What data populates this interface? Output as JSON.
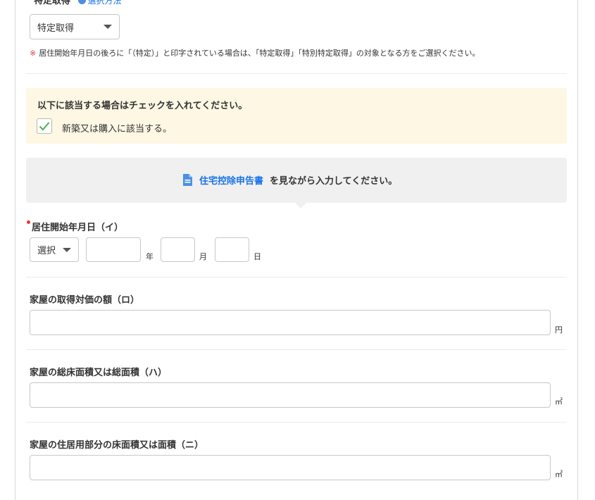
{
  "acquisition": {
    "label": "特定取得",
    "help_text": "選択方法",
    "select_value": "特定取得",
    "note_mark": "※",
    "note_text": "居住開始年月日の後ろに「（特定）」と印字されている場合は、「特定取得」「特別特定取得」の対象となる方をご選択ください。"
  },
  "notice": {
    "title": "以下に該当する場合はチェックを入れてください。",
    "checkbox_label": "新築又は購入に該当する。",
    "checked": true
  },
  "reference": {
    "doc_name": "住宅控除申告書",
    "suffix": "を見ながら入力してください。"
  },
  "residence_date": {
    "label": "居住開始年月日（イ）",
    "era_select": "選択",
    "year_unit": "年",
    "month_unit": "月",
    "day_unit": "日",
    "year_value": "",
    "month_value": "",
    "day_value": ""
  },
  "fields": [
    {
      "label": "家屋の取得対価の額（ロ）",
      "unit": "円",
      "value": ""
    },
    {
      "label": "家屋の総床面積又は総面積（ハ）",
      "unit": "㎡",
      "value": ""
    },
    {
      "label": "家屋の住居用部分の床面積又は面積（ニ）",
      "unit": "㎡",
      "value": ""
    }
  ],
  "colors": {
    "accent": "#1a73e8",
    "required": "#e53935",
    "notice_bg": "#fdf7e3",
    "check": "#4caf50"
  }
}
